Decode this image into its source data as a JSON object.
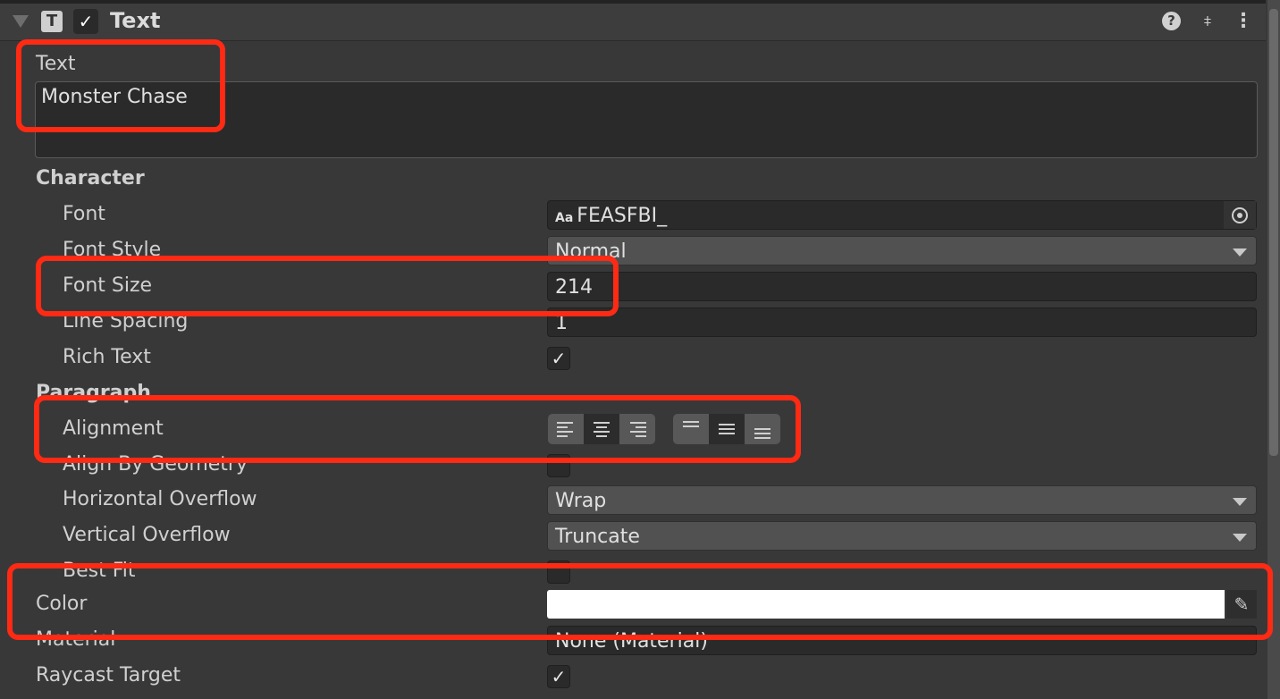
{
  "component": {
    "title": "Text",
    "enabled": true,
    "icons": [
      "foldout-triangle-icon",
      "text-component-icon",
      "help-icon",
      "presets-icon",
      "more-menu-icon"
    ]
  },
  "text_field": {
    "label": "Text",
    "value": "Monster Chase"
  },
  "character": {
    "header": "Character",
    "font_label": "Font",
    "font_value": "FEASFBI_",
    "font_prefix": "Aa",
    "font_style_label": "Font Style",
    "font_style_value": "Normal",
    "font_size_label": "Font Size",
    "font_size_value": "214",
    "line_spacing_label": "Line Spacing",
    "line_spacing_value": "1",
    "rich_text_label": "Rich Text",
    "rich_text_checked": true
  },
  "paragraph": {
    "header": "Paragraph",
    "alignment_label": "Alignment",
    "horizontal_selected": "center",
    "vertical_selected": "middle",
    "align_by_geometry_label": "Align By Geometry",
    "align_by_geometry_checked": false,
    "horizontal_overflow_label": "Horizontal Overflow",
    "horizontal_overflow_value": "Wrap",
    "vertical_overflow_label": "Vertical Overflow",
    "vertical_overflow_value": "Truncate",
    "best_fit_label": "Best Fit",
    "best_fit_checked": false
  },
  "color": {
    "label": "Color",
    "value": "#ffffff"
  },
  "material": {
    "label": "Material",
    "value": "None (Material)"
  },
  "raycast": {
    "label": "Raycast Target",
    "checked": true
  },
  "annotation_color": "#ff2a14"
}
